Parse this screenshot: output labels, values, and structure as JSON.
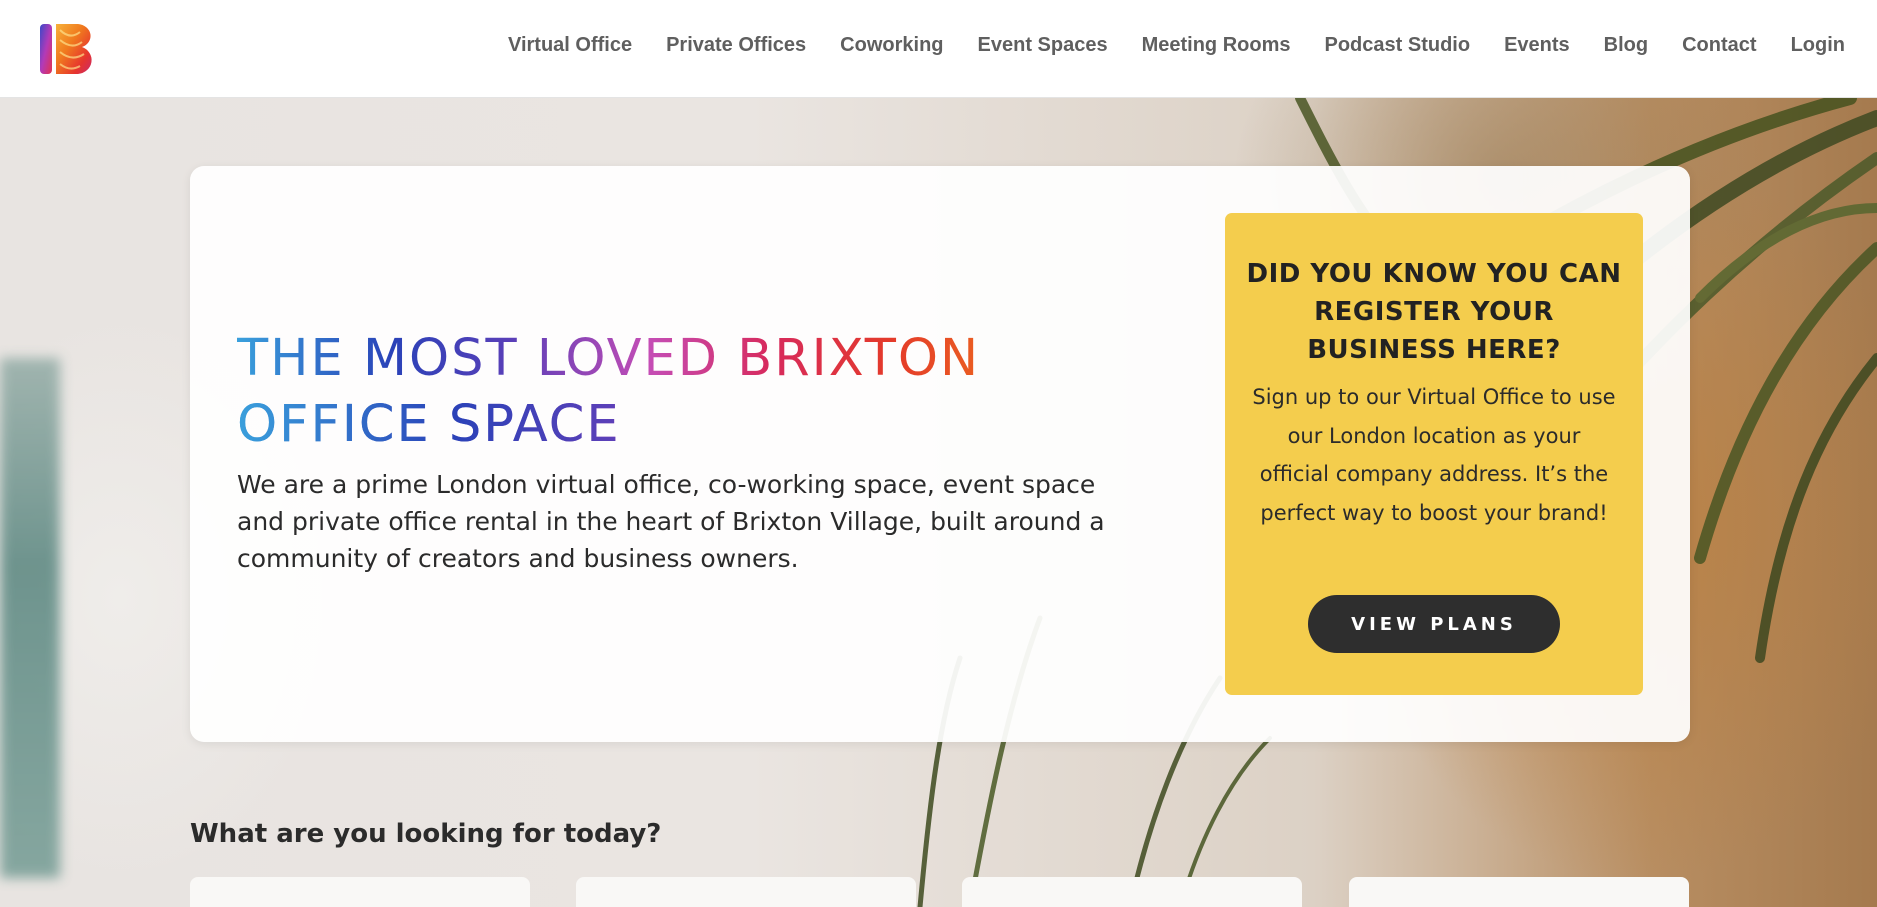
{
  "header": {
    "logo_alt": "IB",
    "nav": [
      {
        "label": "Virtual Office"
      },
      {
        "label": "Private Offices"
      },
      {
        "label": "Coworking"
      },
      {
        "label": "Event Spaces"
      },
      {
        "label": "Meeting Rooms"
      },
      {
        "label": "Podcast Studio"
      },
      {
        "label": "Events"
      },
      {
        "label": "Blog"
      },
      {
        "label": "Contact"
      },
      {
        "label": "Login"
      }
    ]
  },
  "hero": {
    "title_line1": "THE MOST LOVED BRIXTON",
    "title_line2": "OFFICE SPACE",
    "description": "We are a prime London virtual office, co-working space, event space and private office rental in the heart of Brixton Village, built around a community of creators and business owners.",
    "callout": {
      "heading": "DID YOU KNOW YOU CAN REGISTER YOUR BUSINESS HERE?",
      "body": "Sign up to our Virtual Office to use our London location as your official company address. It’s the perfect way to boost your brand!",
      "button_label": "VIEW PLANS"
    }
  },
  "looking_for": {
    "heading": "What are you looking for today?",
    "cards_visible": 4
  },
  "colors": {
    "callout_bg": "#f4cd4d",
    "button_bg": "#2e2e2e",
    "nav_text": "#5f5f5f",
    "heading_gradient": [
      "#3aa0dc",
      "#2a42b8",
      "#c54db5",
      "#d72a5d",
      "#ec6a1e"
    ]
  }
}
